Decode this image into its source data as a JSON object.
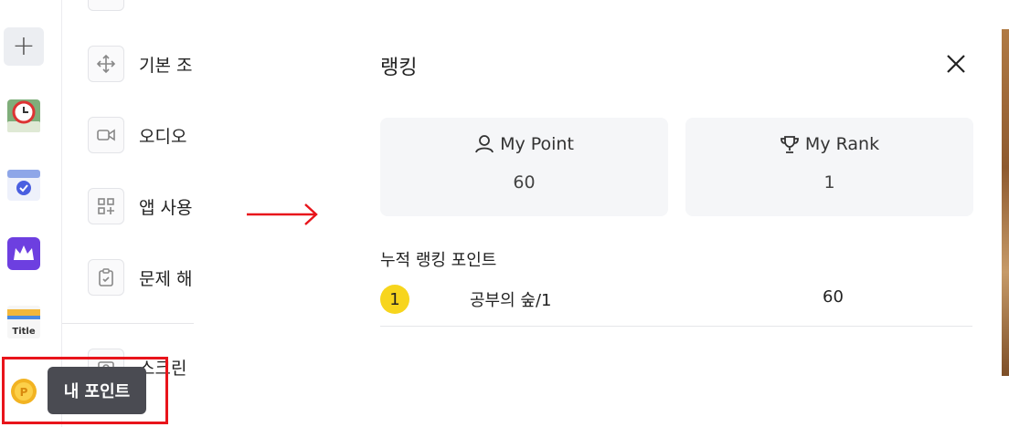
{
  "menu": {
    "items": [
      {
        "label": "기본 조",
        "icon": "move-icon"
      },
      {
        "label": "오디오",
        "icon": "video-icon"
      },
      {
        "label": "앱 사용",
        "icon": "apps-icon"
      },
      {
        "label": "문제 해",
        "icon": "clipboard-icon"
      },
      {
        "label": "스크린",
        "icon": "camera-icon"
      }
    ]
  },
  "tooltip": {
    "label": "내 포인트"
  },
  "ranking": {
    "title": "랭킹",
    "my_point": {
      "label": "My Point",
      "value": "60"
    },
    "my_rank": {
      "label": "My Rank",
      "value": "1"
    },
    "section_title": "누적 랭킹 포인트",
    "rows": [
      {
        "rank": "1",
        "name": "공부의 숲/1",
        "points": "60"
      }
    ]
  },
  "colors": {
    "highlight": "#e8141b",
    "arrow": "#e8141b",
    "rank_badge": "#f7d51d",
    "tooltip_bg": "#4a4b52",
    "card_bg": "#f5f6f8"
  }
}
